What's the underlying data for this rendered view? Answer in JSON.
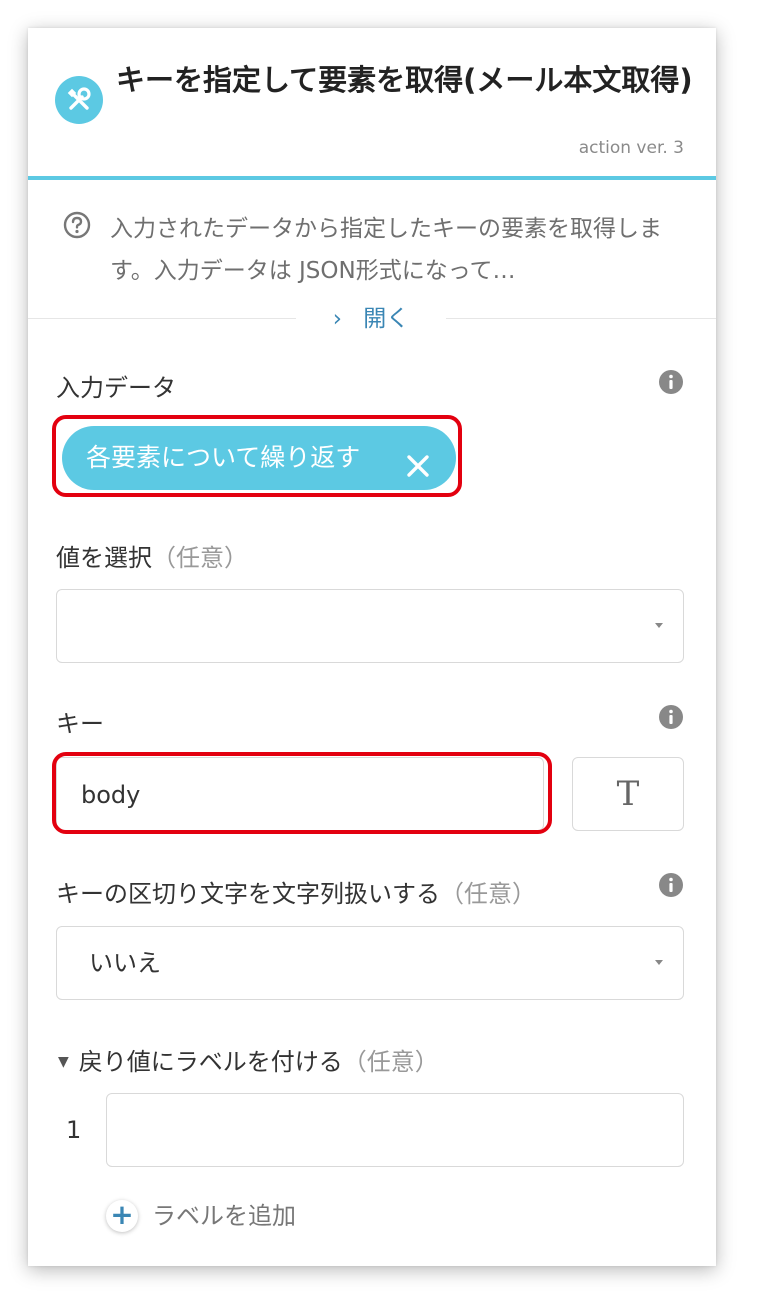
{
  "header": {
    "title": "キーを指定して要素を取得(メール本文取得)",
    "version": "action ver. 3",
    "icon": "tools-icon"
  },
  "description": {
    "text": "入力されたデータから指定したキーの要素を取得します。入力データは JSON形式になって…",
    "icon": "question-circle-icon"
  },
  "open_link": {
    "arrow": "›",
    "label": "開く"
  },
  "input_data": {
    "label": "入力データ",
    "chip_label": "各要素について繰り返す",
    "chip_color": "#5cc9e3",
    "highlight_color": "#e3000f"
  },
  "value_select": {
    "label": "値を選択",
    "optional": "（任意）",
    "value": ""
  },
  "key": {
    "label": "キー",
    "value": "body",
    "type_button": "T"
  },
  "delimiter": {
    "label": "キーの区切り文字を文字列扱いする",
    "optional": "（任意）",
    "value": "いいえ"
  },
  "return_label": {
    "label": "戻り値にラベルを付ける",
    "optional": "（任意）",
    "rows": [
      {
        "index": "1",
        "value": ""
      }
    ],
    "add_label": "ラベルを追加"
  }
}
